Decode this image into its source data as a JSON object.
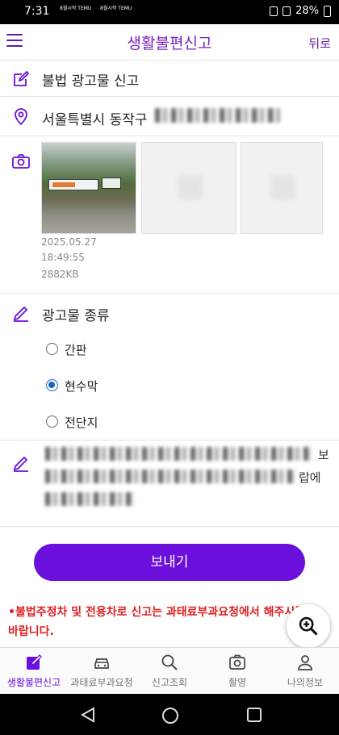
{
  "status_bar": {
    "time": "7:31",
    "battery": "28%",
    "mini_label_1": "8월시작\nTEMU",
    "mini_label_2": "8월시작\nTEMU"
  },
  "header": {
    "title": "생활불편신고",
    "back_label": "뒤로",
    "menu_icon": "hamburger-icon"
  },
  "report_type": {
    "icon": "edit-icon",
    "label": "불법 광고물 신고"
  },
  "location": {
    "icon": "location-pin-icon",
    "label": "서울특별시 동작구"
  },
  "photos": {
    "icon": "camera-icon",
    "items": [
      {
        "date": "2025.05.27",
        "time": "18:49:55",
        "size": "2882KB",
        "banner_text": "커피원가 120원?"
      }
    ]
  },
  "ad_type": {
    "icon": "pencil-icon",
    "label": "광고물 종류",
    "options": [
      {
        "label": "간판",
        "checked": false
      },
      {
        "label": "현수막",
        "checked": true
      },
      {
        "label": "전단지",
        "checked": false
      }
    ]
  },
  "description": {
    "icon": "pencil-icon",
    "tail_1": "보",
    "tail_2": "랍에"
  },
  "send_button": {
    "label": "보내기"
  },
  "notice": {
    "text": "•불법주정차 및 전용차로 신고는 과태료부과요청에서 해주시길 바랍니다."
  },
  "zoom_button": {
    "icon": "zoom-in-icon"
  },
  "bottom_nav": [
    {
      "label": "생활불편신고",
      "icon": "edit-square-icon",
      "active": true
    },
    {
      "label": "과태료부과요청",
      "icon": "car-icon",
      "active": false
    },
    {
      "label": "신고조회",
      "icon": "search-icon",
      "active": false
    },
    {
      "label": "촬영",
      "icon": "camera-icon",
      "active": false
    },
    {
      "label": "나의정보",
      "icon": "person-icon",
      "active": false
    }
  ],
  "colors": {
    "accent": "#6a0fdc",
    "title": "#7a1fc4",
    "notice": "#e01f1f",
    "radio": "#1565c0"
  }
}
